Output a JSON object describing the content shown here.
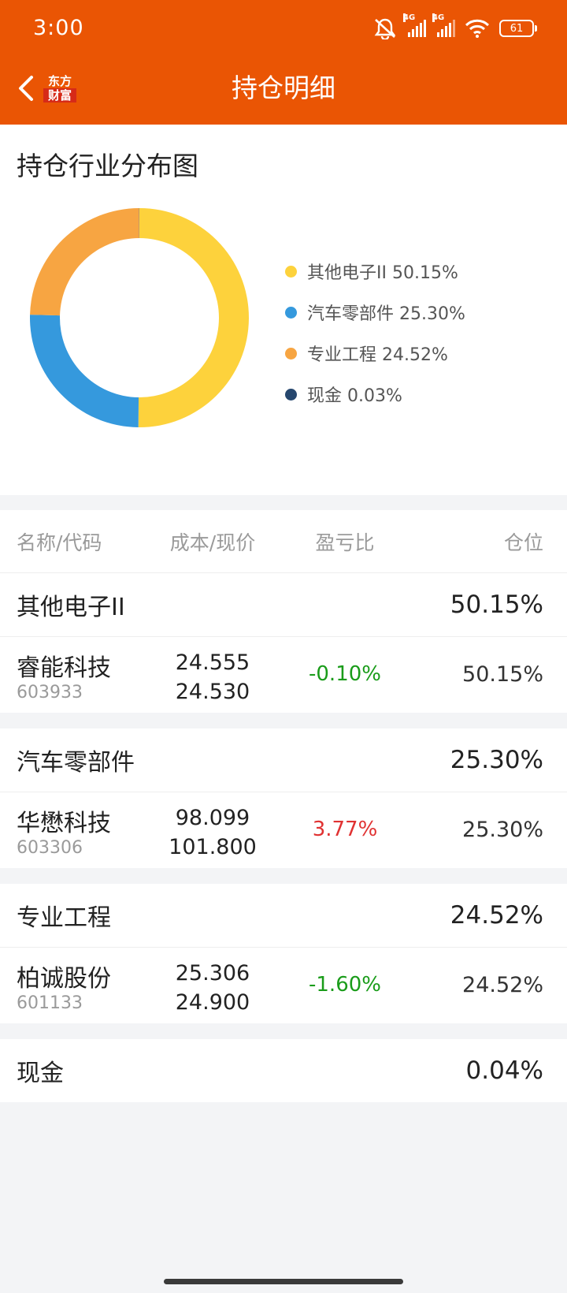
{
  "status": {
    "time": "3:00",
    "network_1": "4G",
    "network_2": "4G",
    "battery": "61"
  },
  "header": {
    "title": "持仓明细",
    "logo_line1": "东方",
    "logo_line2": "财富"
  },
  "chart_section": {
    "title": "持仓行业分布图"
  },
  "chart_data": {
    "type": "pie",
    "style": "donut",
    "categories": [
      "其他电子II",
      "汽车零部件",
      "专业工程",
      "现金"
    ],
    "values": [
      50.15,
      25.3,
      24.52,
      0.03
    ],
    "colors": [
      "#fdd23c",
      "#3599dd",
      "#f7a542",
      "#26476e"
    ],
    "legend": [
      {
        "label": "其他电子II 50.15%",
        "color": "#fdd23c"
      },
      {
        "label": "汽车零部件 25.30%",
        "color": "#3599dd"
      },
      {
        "label": "专业工程 24.52%",
        "color": "#f7a542"
      },
      {
        "label": "现金 0.03%",
        "color": "#26476e"
      }
    ],
    "legend_position": "right"
  },
  "table": {
    "headers": {
      "name": "名称/代码",
      "cost": "成本/现价",
      "ratio": "盈亏比",
      "position": "仓位"
    },
    "groups": [
      {
        "name": "其他电子II",
        "pct": "50.15%",
        "stocks": [
          {
            "name": "睿能科技",
            "code": "603933",
            "cost": "24.555",
            "price": "24.530",
            "ratio": "-0.10%",
            "trend": "down",
            "position": "50.15%"
          }
        ]
      },
      {
        "name": "汽车零部件",
        "pct": "25.30%",
        "stocks": [
          {
            "name": "华懋科技",
            "code": "603306",
            "cost": "98.099",
            "price": "101.800",
            "ratio": "3.77%",
            "trend": "up",
            "position": "25.30%"
          }
        ]
      },
      {
        "name": "专业工程",
        "pct": "24.52%",
        "stocks": [
          {
            "name": "柏诚股份",
            "code": "601133",
            "cost": "25.306",
            "price": "24.900",
            "ratio": "-1.60%",
            "trend": "down",
            "position": "24.52%"
          }
        ]
      },
      {
        "name": "现金",
        "pct": "0.04%",
        "stocks": []
      }
    ]
  },
  "colors": {
    "brand": "#ea5504",
    "up": "#e03232",
    "down": "#1a9c1a"
  }
}
